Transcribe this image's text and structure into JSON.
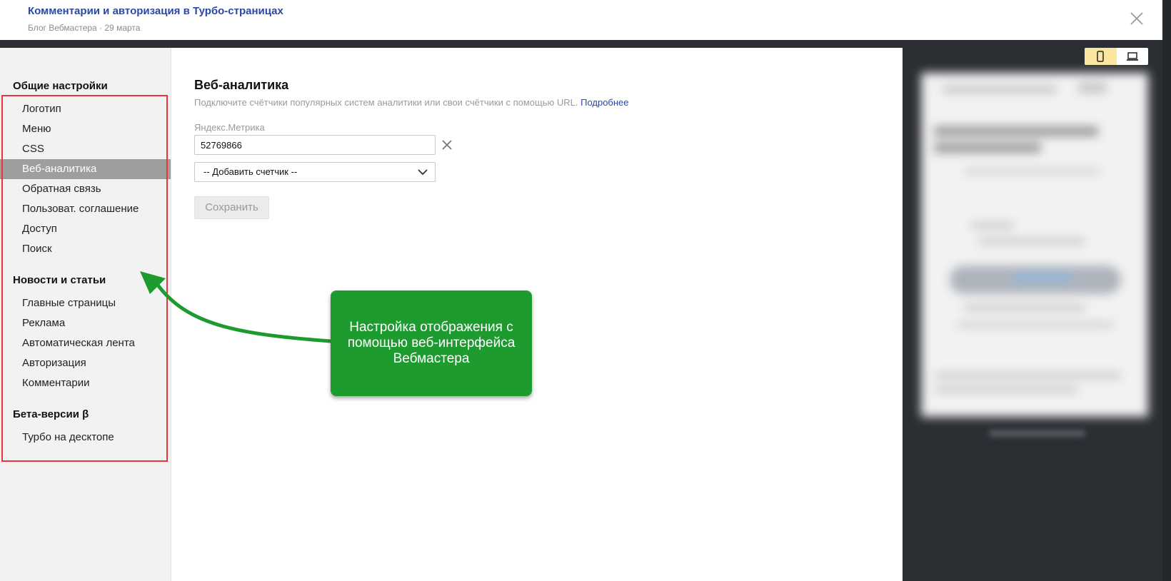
{
  "header": {
    "title": "Комментарии и авторизация в Турбо-страницах",
    "subtitle": "Блог Вебмастера · 29 марта"
  },
  "sidebar": {
    "groups": [
      {
        "title": "Общие настройки",
        "items": [
          {
            "label": "Логотип"
          },
          {
            "label": "Меню"
          },
          {
            "label": "CSS"
          },
          {
            "label": "Веб-аналитика",
            "active": true
          },
          {
            "label": "Обратная связь"
          },
          {
            "label": "Пользоват. соглашение"
          },
          {
            "label": "Доступ"
          },
          {
            "label": "Поиск"
          }
        ]
      },
      {
        "title": "Новости и статьи",
        "items": [
          {
            "label": "Главные страницы"
          },
          {
            "label": "Реклама"
          },
          {
            "label": "Автоматическая лента"
          },
          {
            "label": "Авторизация"
          },
          {
            "label": "Комментарии"
          }
        ]
      },
      {
        "title": "Бета-версии β",
        "items": [
          {
            "label": "Турбо на десктопе"
          }
        ]
      }
    ]
  },
  "main": {
    "title": "Веб-аналитика",
    "description": "Подключите счётчики популярных систем аналитики или свои счётчики с помощью URL.",
    "more_link": "Подробнее",
    "metrika_label": "Яндекс.Метрика",
    "metrika_value": "52769866",
    "add_counter": "-- Добавить счетчик --",
    "save_label": "Сохранить"
  },
  "callout": {
    "text": "Настройка отображения с помощью веб-интерфейса Вебмастера"
  },
  "preview": {
    "device_mobile_icon": "mobile-icon",
    "device_desktop_icon": "laptop-icon"
  },
  "colors": {
    "accent_link": "#2a49a6",
    "active_item_bg": "#9e9e9e",
    "callout_green": "#1d9b2e",
    "highlight_red": "#e8353b",
    "active_device": "#fbe6a0"
  }
}
